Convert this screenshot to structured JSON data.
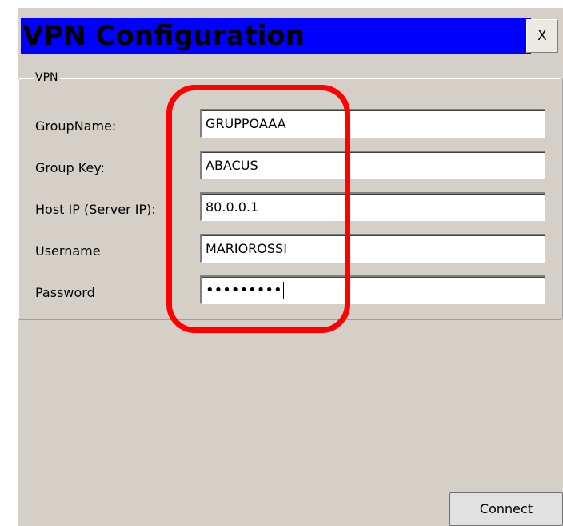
{
  "window": {
    "title": "VPN Configuration",
    "close_label": "X"
  },
  "vpn_group": {
    "legend": "VPN",
    "fields": [
      {
        "label": "GroupName:",
        "value": "GRUPPOAAA"
      },
      {
        "label": "Group Key:",
        "value": "ABACUS"
      },
      {
        "label": "Host IP (Server IP):",
        "value": "80.0.0.1"
      },
      {
        "label": "Username",
        "value": "MARIOROSSI"
      },
      {
        "label": "Password",
        "value": "•••••••••"
      }
    ]
  },
  "actions": {
    "connect_label": "Connect"
  },
  "colors": {
    "titlebar": "#0000ff",
    "window_bg": "#d4d0c8",
    "annotation": "#ff0000"
  }
}
